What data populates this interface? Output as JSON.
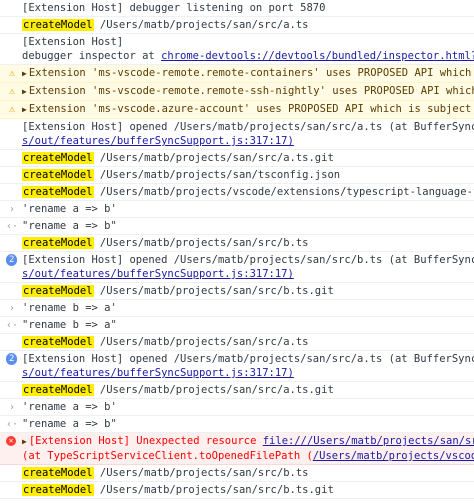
{
  "console": {
    "rows": [
      {
        "text": "[Extension Host] debugger listening on port 5870"
      },
      {
        "badge": "createModel",
        "text": " /Users/matb/projects/san/src/a.ts"
      },
      {
        "line1": "[Extension Host]",
        "line2_prefix": "debugger inspector at ",
        "line2_link": "chrome-devtools://devtools/bundled/inspector.html?experiments="
      },
      {
        "text": "Extension 'ms-vscode-remote.remote-containers' uses PROPOSED API which is subject t"
      },
      {
        "text": "Extension 'ms-vscode-remote.remote-ssh-nightly' uses PROPOSED API which is subject"
      },
      {
        "text": "Extension 'ms-vscode.azure-account' uses PROPOSED API which is subject to change an"
      },
      {
        "line1": "[Extension Host] opened /Users/matb/projects/san/src/a.ts (at BufferSyncSupport.ope",
        "line2_link": "s/out/features/bufferSyncSupport.js:317:17)"
      },
      {
        "badge": "createModel",
        "text": " /Users/matb/projects/san/src/a.ts.git"
      },
      {
        "badge": "createModel",
        "text": " /Users/matb/projects/san/tsconfig.json"
      },
      {
        "badge": "createModel",
        "text": " /Users/matb/projects/vscode/extensions/typescript-language-features/sche"
      },
      {
        "text": "'rename a => b'"
      },
      {
        "text": "\"rename a => b\""
      },
      {
        "badge": "createModel",
        "text": " /Users/matb/projects/san/src/b.ts"
      },
      {
        "count": "2",
        "line1": "[Extension Host] opened /Users/matb/projects/san/src/b.ts (at BufferSyncSupport.open",
        "line2_link": "s/out/features/bufferSyncSupport.js:317:17)"
      },
      {
        "badge": "createModel",
        "text": " /Users/matb/projects/san/src/b.ts.git"
      },
      {
        "text": "'rename b => a'"
      },
      {
        "text": "\"rename b => a\""
      },
      {
        "badge": "createModel",
        "text": " /Users/matb/projects/san/src/a.ts"
      },
      {
        "count": "2",
        "line1": "[Extension Host] opened /Users/matb/projects/san/src/a.ts (at BufferSyncSupport.open",
        "line2_link": "s/out/features/bufferSyncSupport.js:317:17)"
      },
      {
        "badge": "createModel",
        "text": " /Users/matb/projects/san/src/a.ts.git"
      },
      {
        "text": "'rename a => b'"
      },
      {
        "text": "\"rename a => b\""
      },
      {
        "line1_prefix": "[Extension Host] Unexpected resource ",
        "line1_link": "file:///Users/matb/projects/san/src/b.ts",
        "line2_prefix": "(at TypeScriptServiceClient.toOpenedFilePath (",
        "line2_link": "/Users/matb/projects/vscode/extensions/"
      },
      {
        "badge": "createModel",
        "text": " /Users/matb/projects/san/src/b.ts"
      },
      {
        "badge": "createModel",
        "text": " /Users/matb/projects/san/src/b.ts.git"
      }
    ]
  }
}
